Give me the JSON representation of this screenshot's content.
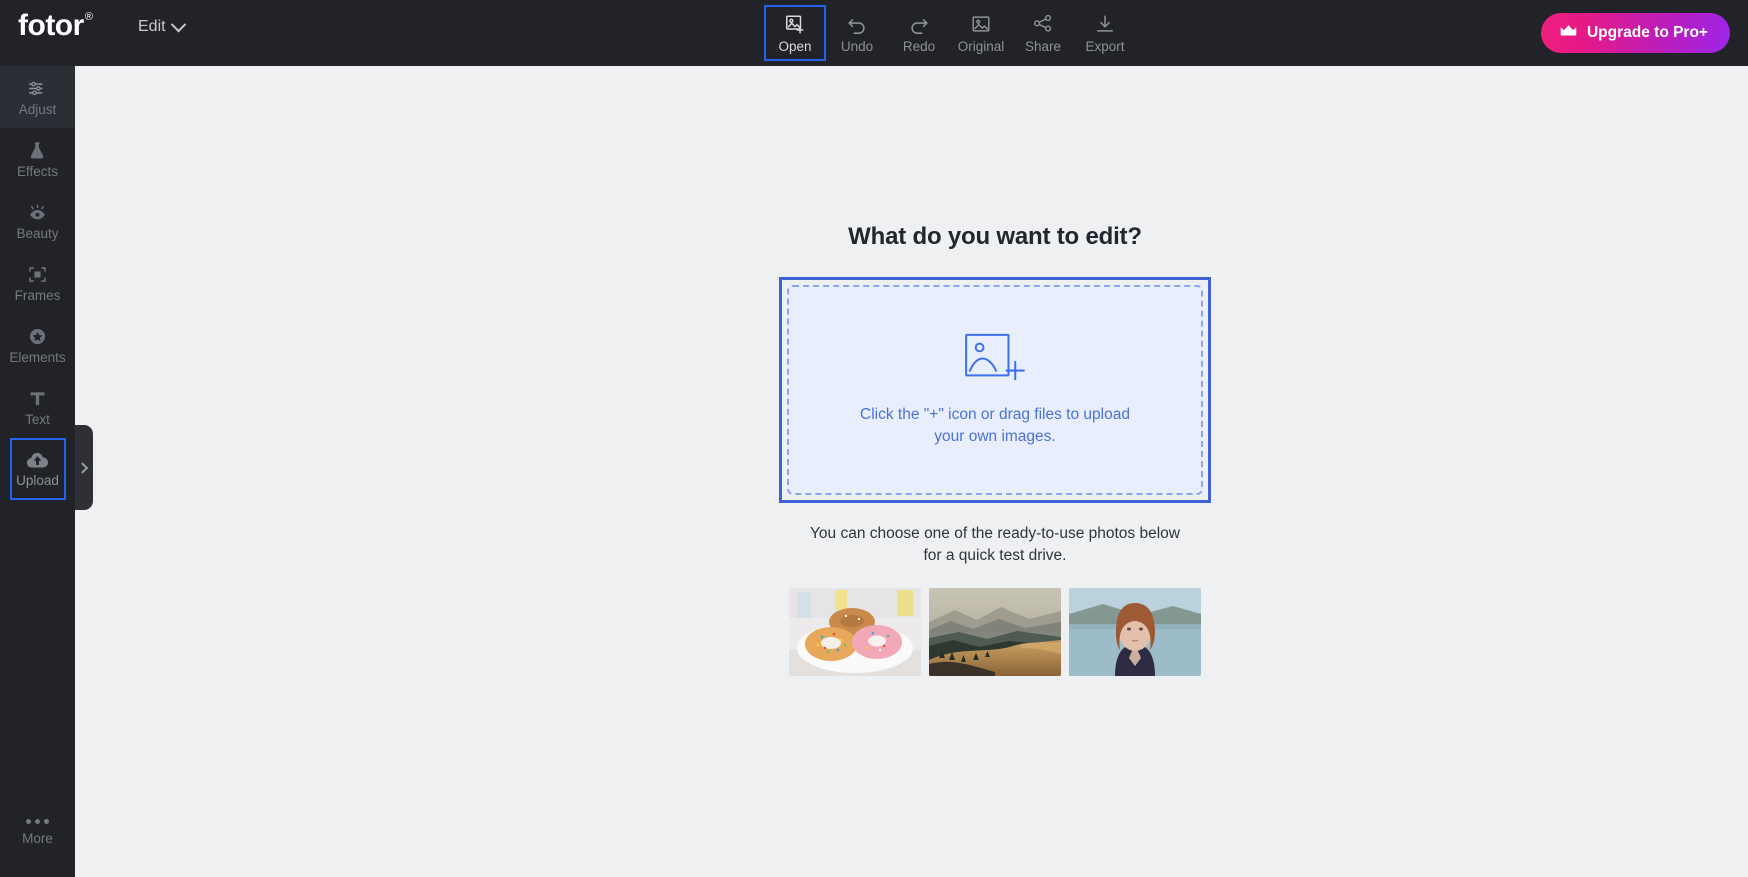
{
  "header": {
    "brand": "fotor",
    "brand_registered": "®",
    "edit_menu_label": "Edit",
    "upgrade_label": "Upgrade to Pro+",
    "upgrade_gradient_from": "#f0207e",
    "upgrade_gradient_to": "#9d26e8",
    "background": "#212328",
    "tools": [
      {
        "label": "Open",
        "icon": "image-add-icon",
        "selected": true
      },
      {
        "label": "Undo",
        "icon": "undo-arrow-icon",
        "selected": false
      },
      {
        "label": "Redo",
        "icon": "redo-arrow-icon",
        "selected": false
      },
      {
        "label": "Original",
        "icon": "image-icon",
        "selected": false
      },
      {
        "label": "Share",
        "icon": "share-nodes-icon",
        "selected": false
      },
      {
        "label": "Export",
        "icon": "download-icon",
        "selected": false
      }
    ]
  },
  "sidebar": {
    "background": "#212328",
    "selection_color": "#2563eb",
    "items": [
      {
        "label": "Adjust",
        "icon": "sliders-icon",
        "state": "hover"
      },
      {
        "label": "Effects",
        "icon": "flask-icon",
        "state": "normal"
      },
      {
        "label": "Beauty",
        "icon": "eye-icon",
        "state": "normal"
      },
      {
        "label": "Frames",
        "icon": "frame-icon",
        "state": "normal"
      },
      {
        "label": "Elements",
        "icon": "star-circle-icon",
        "state": "normal"
      },
      {
        "label": "Text",
        "icon": "text-t-icon",
        "state": "normal"
      },
      {
        "label": "Upload",
        "icon": "cloud-upload-icon",
        "state": "selected"
      }
    ],
    "more_label": "More",
    "more_icon": "ellipsis-icon",
    "collapse_icon": "chevron-right-icon"
  },
  "main": {
    "headline": "What do you want to edit?",
    "dropzone": {
      "line1": "Click the \"+\" icon or drag files to upload",
      "line2": "your own images.",
      "icon": "image-plus-icon",
      "border_color": "#3f62d8",
      "fill_color": "#e8eefc",
      "text_color": "#4a72d8"
    },
    "subtext_line1": "You can choose one of the ready-to-use photos below",
    "subtext_line2": "for a quick test drive.",
    "samples": [
      {
        "name": "donuts-photo",
        "alt": "Three frosted donuts with sprinkles on a white plate"
      },
      {
        "name": "mountains-photo",
        "alt": "Golden hillside with layered mountain ridges at dusk"
      },
      {
        "name": "portrait-photo",
        "alt": "Portrait of a red-haired woman by a lake"
      }
    ],
    "background": "#eff0f2"
  }
}
